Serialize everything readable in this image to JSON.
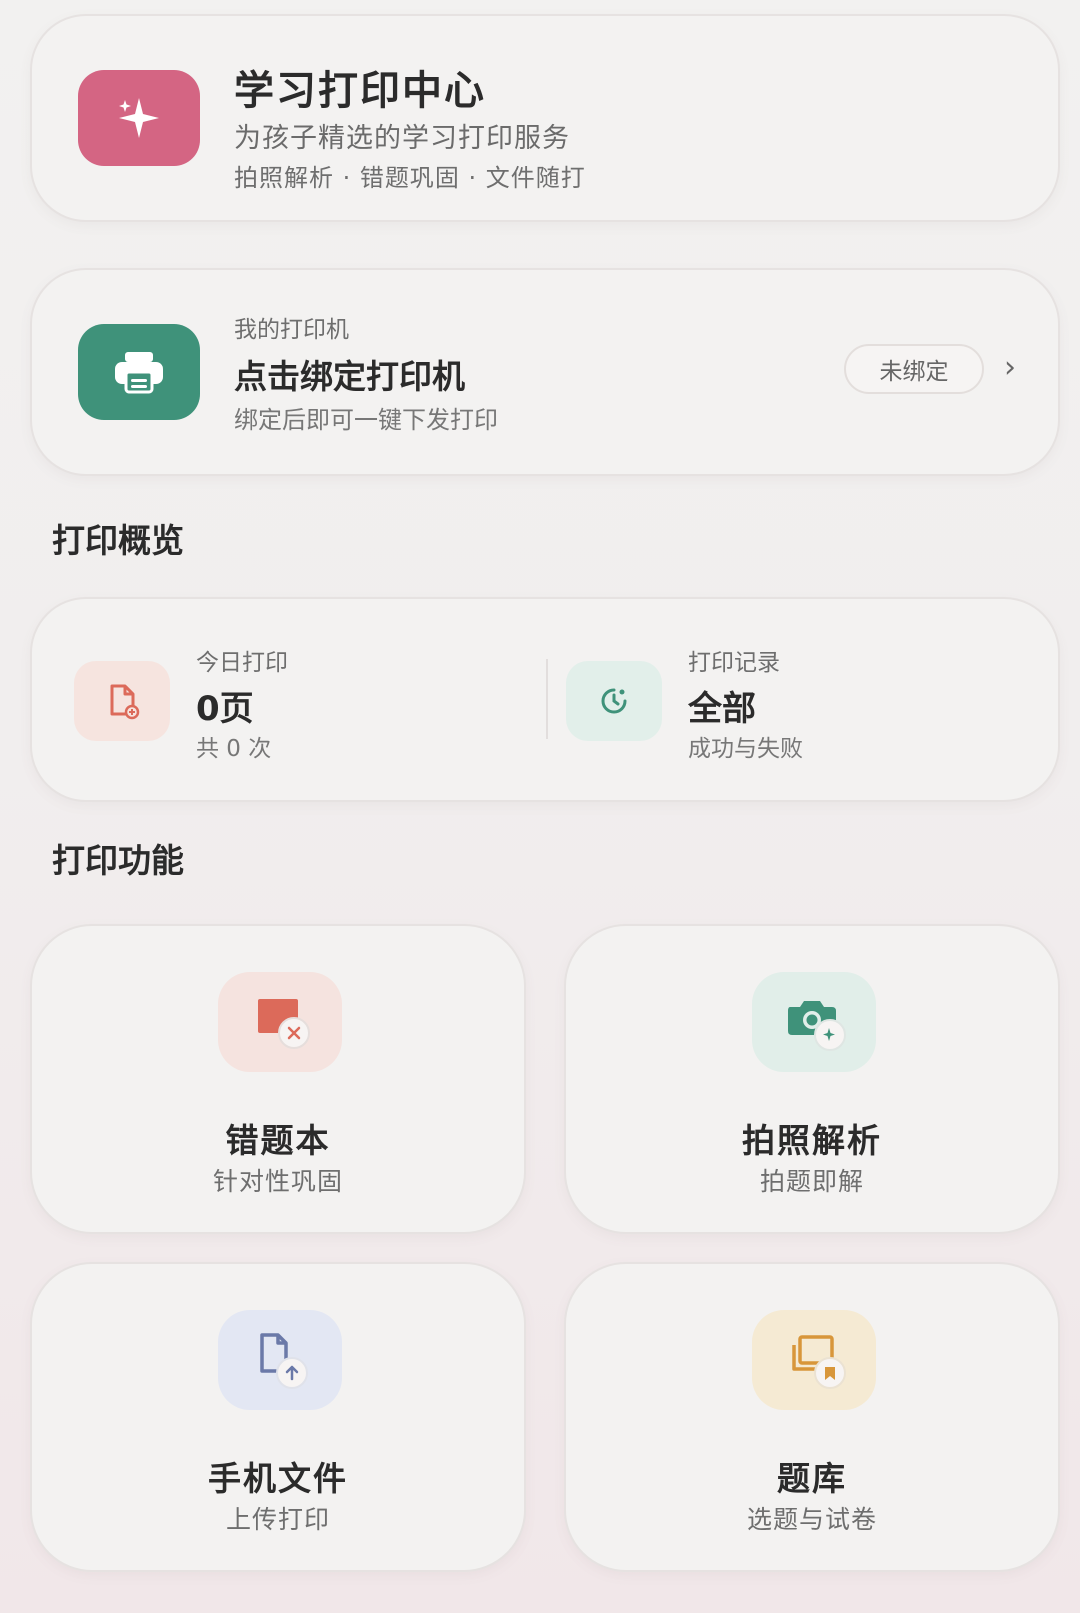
{
  "header": {
    "title": "学习打印中心",
    "subtitle": "为孩子精选的学习打印服务",
    "tags": "拍照解析 · 错题巩固 · 文件随打",
    "icon": "sparkles-icon",
    "icon_bg": "#d46583"
  },
  "printer": {
    "kicker": "我的打印机",
    "title": "点击绑定打印机",
    "hint": "绑定后即可一键下发打印",
    "status": "未绑定",
    "chevron": "›",
    "icon": "printer-icon",
    "icon_bg": "#3f927a"
  },
  "overview": {
    "section_title": "打印概览",
    "today": {
      "label": "今日打印",
      "value": "0页",
      "note": "共 0 次",
      "icon": "document-add-icon"
    },
    "records": {
      "label": "打印记录",
      "value": "全部",
      "note": "成功与失败",
      "icon": "history-icon"
    }
  },
  "functions": {
    "section_title": "打印功能",
    "items": [
      {
        "title": "错题本",
        "subtitle": "针对性巩固",
        "icon": "wrong-questions-icon",
        "accent": "#dc6a5a"
      },
      {
        "title": "拍照解析",
        "subtitle": "拍题即解",
        "icon": "camera-icon",
        "accent": "#3f927a"
      },
      {
        "title": "手机文件",
        "subtitle": "上传打印",
        "icon": "file-upload-icon",
        "accent": "#6b79a8"
      },
      {
        "title": "题库",
        "subtitle": "选题与试卷",
        "icon": "question-bank-icon",
        "accent": "#d8963a"
      }
    ]
  }
}
